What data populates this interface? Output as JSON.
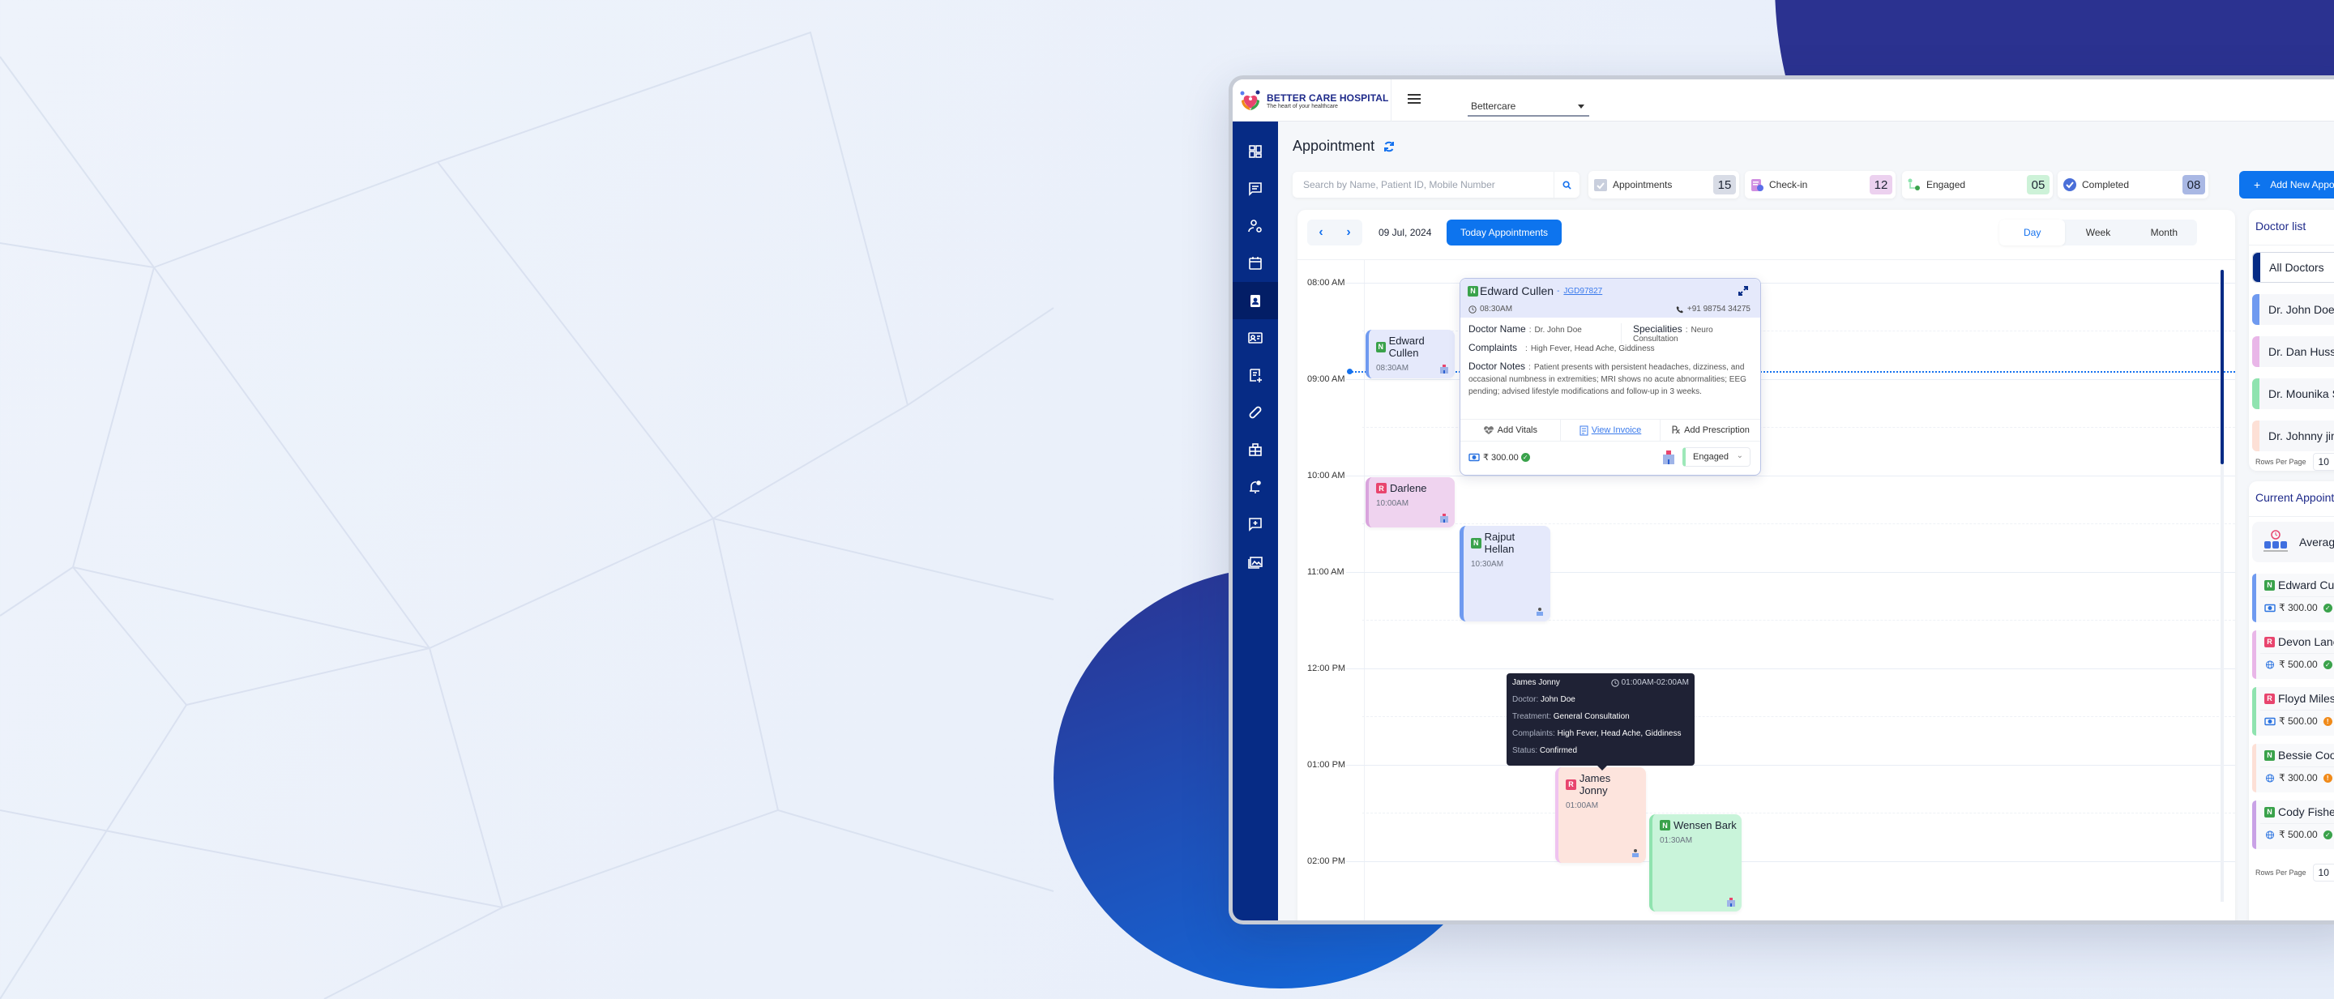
{
  "header": {
    "logo_title": "BETTER CARE HOSPITAL",
    "logo_subtitle": "The heart of your healthcare",
    "branch_select": "Bettercare"
  },
  "sidebar": {
    "items": [
      {
        "icon": "dashboard-icon"
      },
      {
        "icon": "message-icon"
      },
      {
        "icon": "user-settings-icon"
      },
      {
        "icon": "calendar-icon"
      },
      {
        "icon": "appointment-badge-icon",
        "active": true
      },
      {
        "icon": "id-card-icon"
      },
      {
        "icon": "add-document-icon"
      },
      {
        "icon": "pill-icon"
      },
      {
        "icon": "hospital-icon"
      },
      {
        "icon": "notification-icon"
      },
      {
        "icon": "add-comment-icon"
      },
      {
        "icon": "gallery-icon"
      }
    ]
  },
  "page": {
    "title": "Appointment",
    "search_placeholder": "Search by Name, Patient ID, Mobile Number",
    "add_button": "Add New Appointment"
  },
  "stats": [
    {
      "label": "Appointments",
      "count": "15",
      "color": "#d8dce6"
    },
    {
      "label": "Check-in",
      "count": "12",
      "color": "#ecd1ef"
    },
    {
      "label": "Engaged",
      "count": "05",
      "color": "#cdf2d8"
    },
    {
      "label": "Completed",
      "count": "08",
      "color": "#a9b8e4"
    }
  ],
  "calendar": {
    "date": "09 Jul, 2024",
    "today_button": "Today Appointments",
    "views": [
      "Day",
      "Week",
      "Month"
    ],
    "active_view": "Day",
    "time_labels": [
      "08:00 AM",
      "09:00 AM",
      "10:00 AM",
      "11:00 AM",
      "12:00 PM",
      "01:00 PM",
      "02:00 PM"
    ],
    "appointments": [
      {
        "name": "Edward Cullen",
        "time": "08:30AM",
        "type": "N",
        "color": "#e5e9fb",
        "accent": "#6f9af0"
      },
      {
        "name": "Darlene",
        "time": "10:00AM",
        "type": "R",
        "color": "#efd3ef",
        "accent": "#d9a4dd"
      },
      {
        "name": "Rajput Hellan",
        "time": "10:30AM",
        "type": "N",
        "color": "#e5e9fb",
        "accent": "#6f9af0"
      },
      {
        "name": "James Jonny",
        "time": "01:00AM",
        "type": "R",
        "color": "#fde4dd",
        "accent": "#efc3ef"
      },
      {
        "name": "Wensen Bark",
        "time": "01:30AM",
        "type": "N",
        "color": "#c9f4da",
        "accent": "#8fe3af"
      }
    ]
  },
  "popover": {
    "name": "Edward Cullen",
    "patient_id": "JGD97827",
    "time": "08:30AM",
    "phone": "+91 98754 34275",
    "doctor_label": "Doctor Name",
    "doctor": "Dr. John Doe",
    "speciality_label": "Specialities",
    "speciality": "Neuro Consultation",
    "complaints_label": "Complaints",
    "complaints": "High Fever, Head Ache, Giddiness",
    "notes_label": "Doctor Notes",
    "notes": "Patient presents with persistent headaches, dizziness, and occasional numbness in extremities; MRI shows no acute abnormalities; EEG pending; advised lifestyle modifications and follow-up in 3 weeks.",
    "actions": [
      "Add Vitals",
      "View Invoice",
      "Add Prescription"
    ],
    "amount": "₹ 300.00",
    "status": "Engaged"
  },
  "tooltip": {
    "name": "James Jonny",
    "time": "01:00AM-02:00AM",
    "doctor_label": "Doctor:",
    "doctor": "John Doe",
    "treatment_label": "Treatment:",
    "treatment": "General Consultation",
    "complaints_label": "Complaints:",
    "complaints": "High Fever, Head Ache, Giddiness",
    "status_label": "Status:",
    "status": "Confirmed"
  },
  "doctor_list": {
    "title": "Doctor list",
    "items": [
      {
        "name": "All Doctors",
        "color": "#062b85",
        "active": true
      },
      {
        "name": "Dr. John Doe",
        "color": "#6f9af0"
      },
      {
        "name": "Dr. Dan Hussy",
        "color": "#e9b6e8"
      },
      {
        "name": "Dr. Mounika S",
        "color": "#8fe3af"
      },
      {
        "name": "Dr. Johnny jim",
        "color": "#fde0d6"
      }
    ],
    "rows_per_page_label": "Rows Per Page",
    "rows_per_page": "10"
  },
  "current_appointments": {
    "title": "Current Appointments",
    "average_label": "Average",
    "items": [
      {
        "name": "Edward Cullen",
        "type": "N",
        "amount": "₹ 300.00",
        "payment": "cash",
        "status": "paid",
        "color": "#6f9af0"
      },
      {
        "name": "Devon Lane",
        "type": "R",
        "amount": "₹ 500.00",
        "payment": "online",
        "status": "paid",
        "color": "#e9b6e8"
      },
      {
        "name": "Floyd Miles",
        "type": "R",
        "amount": "₹ 500.00",
        "payment": "cash",
        "status": "pending",
        "color": "#8fe3af"
      },
      {
        "name": "Bessie Cooper",
        "type": "N",
        "amount": "₹ 300.00",
        "payment": "online",
        "status": "pending",
        "color": "#fde0d6"
      },
      {
        "name": "Cody Fisher",
        "type": "N",
        "amount": "₹ 500.00",
        "payment": "online",
        "status": "paid",
        "color": "#c9a2e6"
      }
    ],
    "rows_per_page_label": "Rows Per Page",
    "rows_per_page": "10"
  }
}
